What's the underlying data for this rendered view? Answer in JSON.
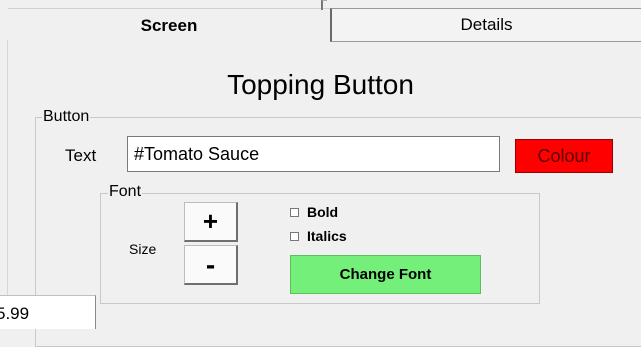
{
  "tabs": {
    "screen": "Screen",
    "details": "Details"
  },
  "title": "Topping Button",
  "button_group": {
    "legend": "Button",
    "text_label": "Text",
    "text_value": "#Tomato Sauce",
    "colour_label": "Colour",
    "colour_value": "#ff0000"
  },
  "font_group": {
    "legend": "Font",
    "size_label": "Size",
    "increase_label": "+",
    "decrease_label": "-",
    "bold_label": "Bold",
    "bold_checked": false,
    "italics_label": "Italics",
    "italics_checked": false,
    "change_font_label": "Change Font",
    "change_font_color": "#74f07a"
  },
  "background_field": {
    "value": "5.99"
  }
}
